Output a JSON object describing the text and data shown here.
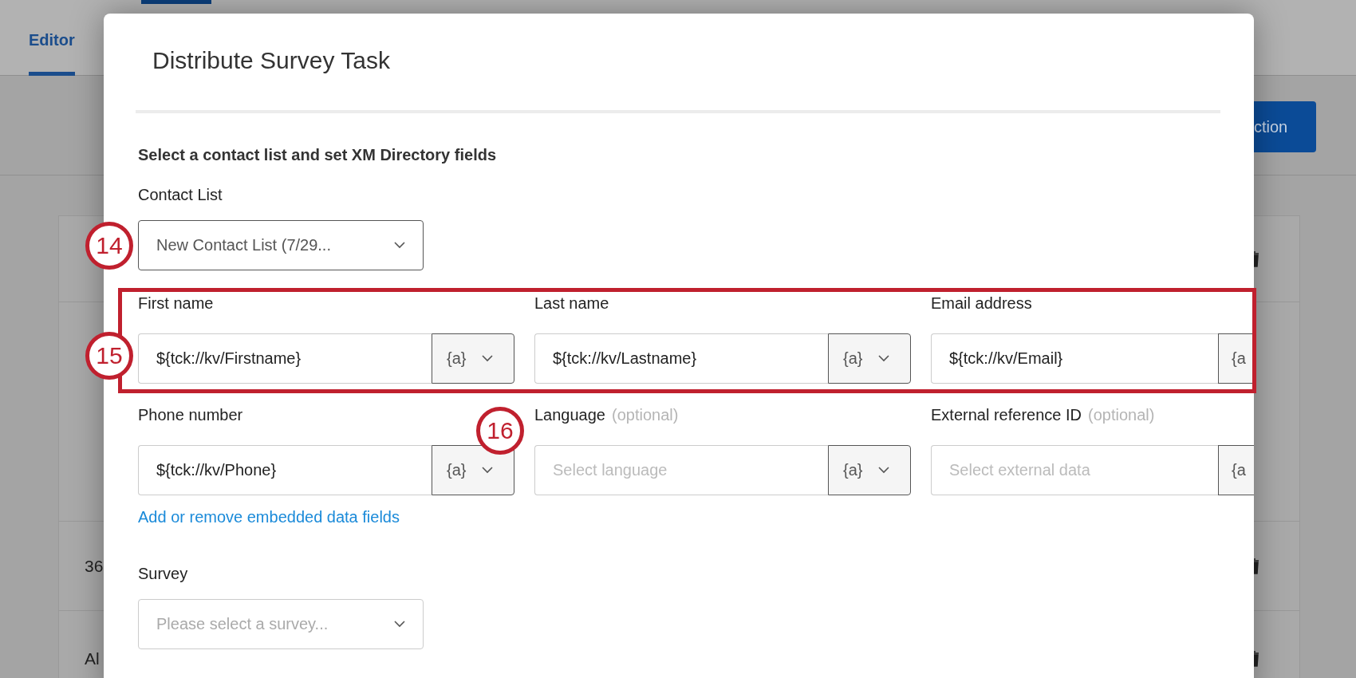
{
  "background": {
    "tabs": [
      {
        "label": "Editor",
        "selected": true
      }
    ],
    "toolbar_button": "ction",
    "rows": [
      {
        "kind": "blank"
      },
      {
        "kind": "blank"
      },
      {
        "kind": "text",
        "text": "36"
      },
      {
        "kind": "text",
        "text": "Al"
      }
    ]
  },
  "dialog": {
    "title": "Distribute Survey Task",
    "section_heading": "Select a contact list and set XM Directory fields",
    "contact_list": {
      "label": "Contact List",
      "value": "New Contact List (7/29...",
      "marker": "14"
    },
    "field_rows": [
      {
        "highlighted": true,
        "marker": "15",
        "fields": [
          {
            "kind": "full",
            "label": "First name",
            "value": "${tck://kv/Firstname}",
            "token": "{a}"
          },
          {
            "kind": "full",
            "label": "Last name",
            "value": "${tck://kv/Lastname}",
            "token": "{a}"
          },
          {
            "kind": "clipped",
            "label": "Email address",
            "value": "${tck://kv/Email}",
            "token": "{a"
          }
        ]
      },
      {
        "fields": [
          {
            "kind": "full",
            "label": "Phone number",
            "value": "${tck://kv/Phone}",
            "token": "{a}",
            "marker": "16"
          },
          {
            "kind": "full",
            "label": "Language",
            "hint": "(optional)",
            "placeholder": "Select language",
            "token": "{a}"
          },
          {
            "kind": "clipped",
            "label": "External reference ID",
            "hint": "(optional)",
            "placeholder": "Select external data",
            "token": "{a"
          }
        ]
      }
    ],
    "link": "Add or remove embedded data fields",
    "survey": {
      "label": "Survey",
      "placeholder": "Please select a survey..."
    }
  }
}
